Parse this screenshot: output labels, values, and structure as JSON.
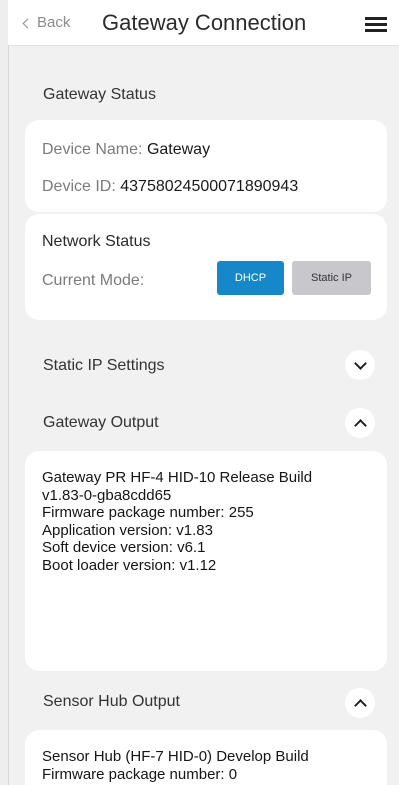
{
  "header": {
    "back_label": "Back",
    "title": "Gateway Connection"
  },
  "gateway_status": {
    "heading": "Gateway Status",
    "device_name_label": "Device Name:",
    "device_name_value": "Gateway",
    "device_id_label": "Device ID:",
    "device_id_value": "43758024500071890943"
  },
  "network_status": {
    "heading": "Network Status",
    "mode_label": "Current Mode:",
    "dhcp_label": "DHCP",
    "static_label": "Static IP",
    "selected": "DHCP"
  },
  "static_ip_settings": {
    "heading": "Static IP Settings",
    "expanded": false
  },
  "gateway_output": {
    "heading": "Gateway Output",
    "expanded": true,
    "lines": [
      "Gateway PR HF-4 HID-10 Release Build",
      "v1.83-0-gba8cdd65",
      "Firmware package number: 255",
      "Application version: v1.83",
      "Soft device version: v6.1",
      "Boot loader version: v1.12"
    ]
  },
  "sensor_hub_output": {
    "heading": "Sensor Hub Output",
    "expanded": true,
    "lines": [
      "Sensor Hub (HF-7 HID-0) Develop Build",
      "Firmware package number: 0"
    ]
  },
  "colors": {
    "accent": "#1688c9",
    "background": "#f1f1f1",
    "card": "#ffffff"
  },
  "icons": [
    "back-chevron-icon",
    "hamburger-menu-icon",
    "chevron-down-icon",
    "chevron-up-icon"
  ]
}
